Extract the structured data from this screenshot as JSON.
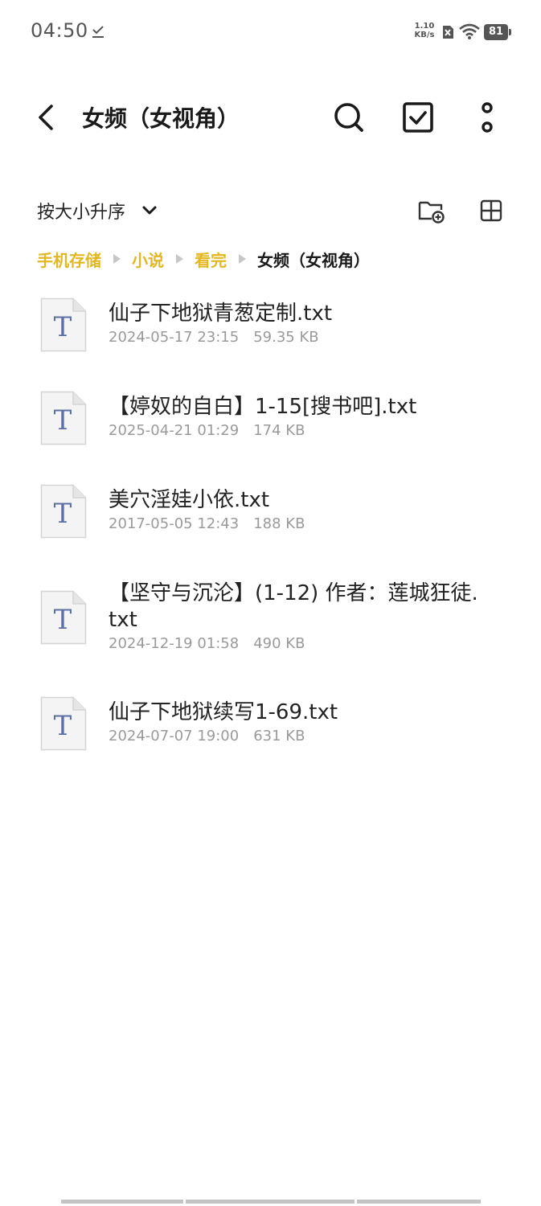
{
  "status_bar": {
    "time": "04:50",
    "net_speed_value": "1.10",
    "net_speed_unit": "KB/s",
    "battery": "81"
  },
  "header": {
    "title": "女频（女视角）"
  },
  "toolbar": {
    "sort_label": "按大小升序"
  },
  "breadcrumb": [
    "手机存储",
    "小说",
    "看完",
    "女频（女视角）"
  ],
  "files": [
    {
      "name": "仙子下地狱青葱定制.txt",
      "date": "2024-05-17 23:15",
      "size": "59.35 KB",
      "icon": "text-file-icon"
    },
    {
      "name": "【婷奴的自白】1-15[搜书吧].txt",
      "date": "2025-04-21 01:29",
      "size": "174 KB",
      "icon": "text-file-icon"
    },
    {
      "name": "美穴淫娃小依.txt",
      "date": "2017-05-05 12:43",
      "size": "188 KB",
      "icon": "text-file-icon"
    },
    {
      "name": "【坚守与沉沦】(1-12) 作者：莲城狂徒.txt",
      "date": "2024-12-19 01:58",
      "size": "490 KB",
      "icon": "text-file-icon"
    },
    {
      "name": "仙子下地狱续写1-69.txt",
      "date": "2024-07-07 19:00",
      "size": "631 KB",
      "icon": "text-file-icon"
    }
  ],
  "colors": {
    "accent": "#e2b722",
    "file_icon_letter": "#5b6fa6",
    "meta_text": "#9a9a9a"
  }
}
